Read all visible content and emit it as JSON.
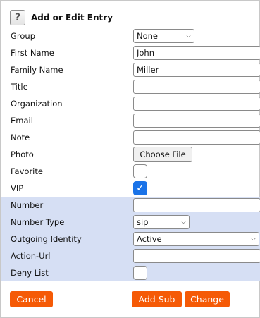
{
  "header": {
    "help_icon": "?",
    "title": "Add or Edit Entry"
  },
  "fields": {
    "group": {
      "label": "Group",
      "value": "None"
    },
    "first_name": {
      "label": "First Name",
      "value": "John"
    },
    "family_name": {
      "label": "Family Name",
      "value": "Miller"
    },
    "title": {
      "label": "Title",
      "value": ""
    },
    "organization": {
      "label": "Organization",
      "value": ""
    },
    "email": {
      "label": "Email",
      "value": ""
    },
    "note": {
      "label": "Note",
      "value": ""
    },
    "photo": {
      "label": "Photo",
      "button": "Choose File"
    },
    "favorite": {
      "label": "Favorite",
      "checked": false
    },
    "vip": {
      "label": "VIP",
      "checked": true,
      "check_glyph": "✓"
    },
    "number": {
      "label": "Number",
      "value": ""
    },
    "number_type": {
      "label": "Number Type",
      "value": "sip"
    },
    "outgoing_identity": {
      "label": "Outgoing Identity",
      "value": "Active"
    },
    "action_url": {
      "label": "Action-Url",
      "value": ""
    },
    "deny_list": {
      "label": "Deny List",
      "checked": false
    }
  },
  "buttons": {
    "cancel": "Cancel",
    "add_sub": "Add Sub",
    "change": "Change"
  },
  "colors": {
    "accent": "#f55a06",
    "shade": "#d6dff4",
    "check": "#1a73e8"
  }
}
